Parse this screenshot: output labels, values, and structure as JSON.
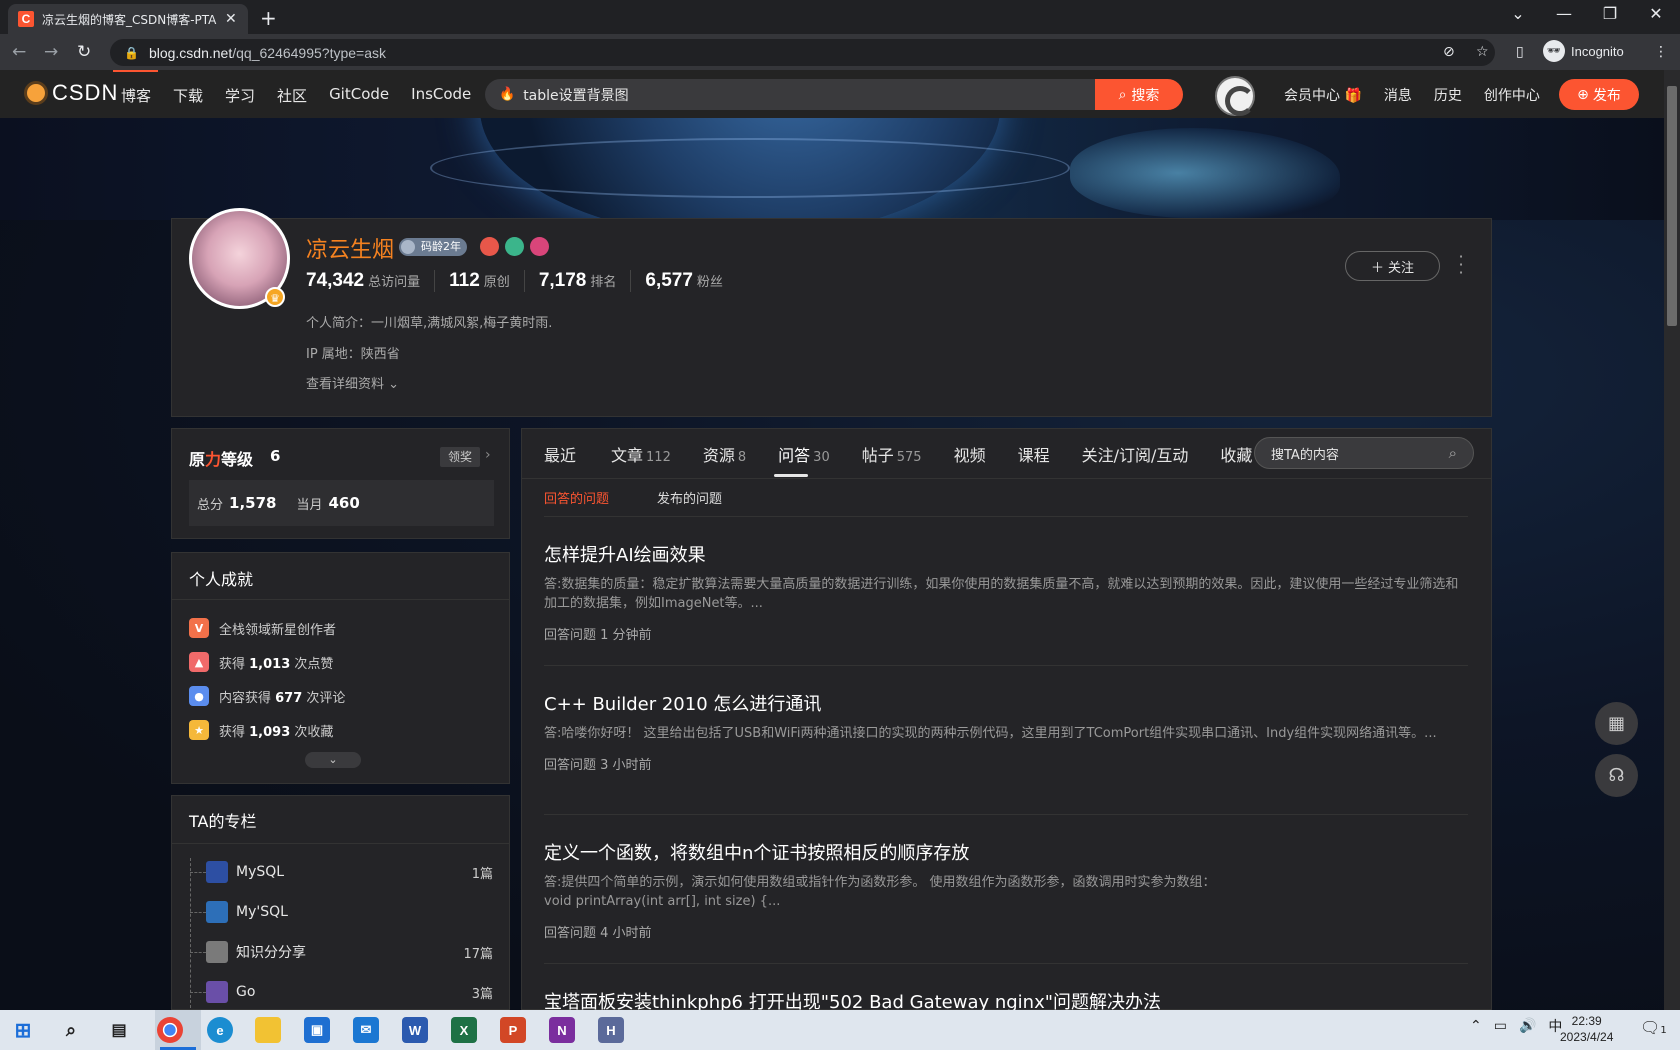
{
  "browser": {
    "tab_title": "凉云生烟的博客_CSDN博客-PTA",
    "url_domain": "blog.csdn.net",
    "url_path": "/qq_62464995?type=ask",
    "profile_label": "Incognito"
  },
  "csdn_nav": {
    "logo": "CSDN",
    "links": [
      "博客",
      "下载",
      "学习",
      "社区",
      "GitCode",
      "InsCode"
    ],
    "search_query": "table设置背景图",
    "search_button": "搜索",
    "right_links": [
      "会员中心 🎁",
      "消息",
      "历史",
      "创作中心"
    ],
    "publish_button": "发布"
  },
  "profile": {
    "name": "凉云生烟",
    "code_age": "码龄2年",
    "stats": [
      {
        "num": "74,342",
        "label": "总访问量"
      },
      {
        "num": "112",
        "label": "原创"
      },
      {
        "num": "7,178",
        "label": "排名"
      },
      {
        "num": "6,577",
        "label": "粉丝"
      }
    ],
    "bio": "个人简介：一川烟草,满城风絮,梅子黄时雨.",
    "ip": "IP 属地：陕西省",
    "details_link": "查看详细资料",
    "follow_button": "关注"
  },
  "level": {
    "title_part1": "原",
    "title_part2": "力",
    "title_part3": "等级",
    "level": "6",
    "collect": "领奖",
    "total_label": "总分",
    "total": "1,578",
    "month_label": "当月",
    "month": "460"
  },
  "achievements": {
    "title": "个人成就",
    "items": [
      {
        "pre": "全栈领域新星创作者",
        "num": "",
        "post": "",
        "color": "#f2714a",
        "icon": "V"
      },
      {
        "pre": "获得 ",
        "num": "1,013",
        "post": " 次点赞",
        "color": "#f06a6a",
        "icon": "👍"
      },
      {
        "pre": "内容获得 ",
        "num": "677",
        "post": " 次评论",
        "color": "#5b8dee",
        "icon": "💬"
      },
      {
        "pre": "获得 ",
        "num": "1,093",
        "post": " 次收藏",
        "color": "#f5b83a",
        "icon": "★"
      }
    ]
  },
  "columns": {
    "title": "TA的专栏",
    "items": [
      {
        "name": "MySQL",
        "count": "1篇",
        "color": "#2d4fa3"
      },
      {
        "name": "My'SQL",
        "count": "",
        "color": "#2d6fb8"
      },
      {
        "name": "知识分分享",
        "count": "17篇",
        "color": "#7a7a7a"
      },
      {
        "name": "Go",
        "count": "3篇",
        "color": "#6a4fa8"
      }
    ]
  },
  "tabs": [
    {
      "label": "最近",
      "count": ""
    },
    {
      "label": "文章",
      "count": "112"
    },
    {
      "label": "资源",
      "count": "8"
    },
    {
      "label": "问答",
      "count": "30"
    },
    {
      "label": "帖子",
      "count": "575"
    },
    {
      "label": "视频",
      "count": ""
    },
    {
      "label": "课程",
      "count": ""
    },
    {
      "label": "关注/订阅/互动",
      "count": ""
    },
    {
      "label": "收藏",
      "count": ""
    }
  ],
  "inner_search_placeholder": "搜TA的内容",
  "subtabs": [
    "回答的问题",
    "发布的问题"
  ],
  "questions": [
    {
      "title": "怎样提升AI绘画效果",
      "body": "答:数据集的质量：稳定扩散算法需要大量高质量的数据进行训练，如果你使用的数据集质量不高，就难以达到预期的效果。因此，建议使用一些经过专业筛选和加工的数据集，例如ImageNet等。...",
      "meta": "回答问题 1 分钟前"
    },
    {
      "title": "C++ Builder 2010 怎么进行通讯",
      "body": "答:哈喽你好呀！ 这里给出包括了USB和WiFi两种通讯接口的实现的两种示例代码，这里用到了TComPort组件实现串口通讯、Indy组件实现网络通讯等。...",
      "meta": "回答问题 3 小时前"
    },
    {
      "title": "定义一个函数，将数组中n个证书按照相反的顺序存放",
      "body": "答:提供四个简单的示例，演示如何使用数组或指针作为函数形参。 使用数组作为函数形参，函数调用时实参为数组：\nvoid printArray(int arr[], int size) {...",
      "meta": "回答问题 4 小时前"
    },
    {
      "title": "宝塔面板安装thinkphp6 打开出现\"502 Bad Gateway nginx\"问题解决办法",
      "body": "",
      "meta": ""
    }
  ],
  "taskbar": {
    "time": "22:39",
    "date": "2023/4/24",
    "ime": "中",
    "notification_count": "1"
  }
}
